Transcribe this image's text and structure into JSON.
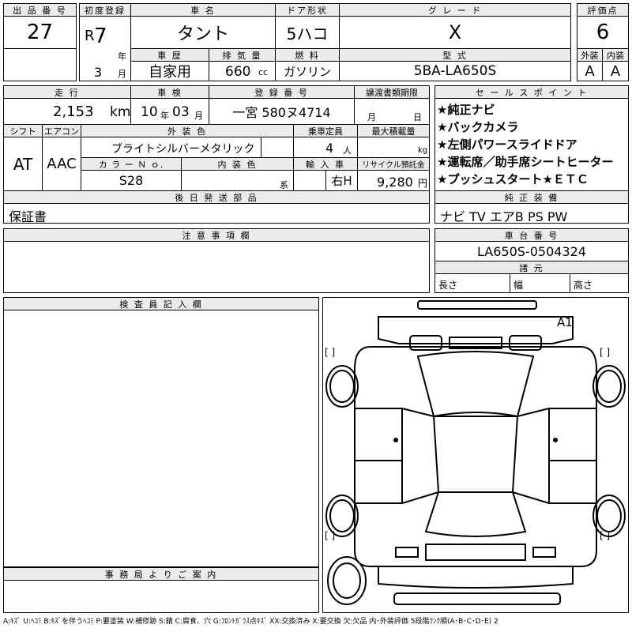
{
  "headers": {
    "lot_no": "出 品 番 号",
    "first_reg": "初度登録",
    "car_name": "車 名",
    "door": "ドア形状",
    "grade": "グ レ ー ド",
    "score": "評価点",
    "history": "車 歴",
    "displacement": "排 気 量",
    "fuel": "燃 料",
    "model": "型 式",
    "exterior": "外装",
    "interior": "内装",
    "mileage": "走 行",
    "inspection": "車 検",
    "plate": "登 録 番 号",
    "transfer": "譲渡書類期限",
    "selling": "セ ー ル ス ポ イ ン ト",
    "shift": "シフト",
    "ac": "エアコン",
    "color": "外 装 色",
    "capacity": "乗車定員",
    "load": "最大積載量",
    "color_no": "カ ラ ー Ｎ ｏ.",
    "int_color": "内 装 色",
    "import": "輸 入 車",
    "recycle": "リサイクル預託金",
    "later_parts": "後 日 発 送 部 品",
    "genuine": "純 正 装 備",
    "notes": "注 意 事 項 欄",
    "chassis": "車 台 番 号",
    "dims": "諸 元",
    "inspector": "検 査 員 記 入 欄",
    "office": "事 務 局 よ り ご 案 内"
  },
  "values": {
    "lot_no": "27",
    "era": "R",
    "year": "7",
    "year_unit": "年",
    "month": "3",
    "month_unit": "月",
    "car_name": "タント",
    "door": "5ハコ",
    "grade": "X",
    "score": "6",
    "history": "自家用",
    "displacement": "660",
    "displacement_unit": "cc",
    "fuel": "ガソリン",
    "model": "5BA-LA650S",
    "exterior": "A",
    "interior": "A",
    "mileage": "2,153",
    "mileage_unit": "km",
    "insp_year": "10",
    "insp_year_unit": "年",
    "insp_month": "03",
    "insp_month_unit": "月",
    "plate": "一宮 580ヌ4714",
    "transfer_month": "月",
    "transfer_day": "日",
    "shift": "AT",
    "ac": "AAC",
    "color": "ブライトシルバーメタリック",
    "capacity": "4",
    "capacity_unit": "人",
    "load_unit": "kg",
    "color_no": "S28",
    "int_color_unit": "系",
    "import": "右H",
    "recycle": "9,280",
    "recycle_unit": "円",
    "later_parts": "保証書",
    "genuine": "ナビ TV エアB PS PW",
    "chassis": "LA650S-0504324",
    "dim_length": "長さ",
    "dim_width": "幅",
    "dim_height": "高さ",
    "diagram_mark": "A1",
    "legend": "A:ｷｽﾞ U:ﾍｺﾐ B:ｷｽﾞを伴うﾍｺﾐ P:要塗装 W:補修跡 S:錆 C:腐食、穴 G:ﾌﾛﾝﾄｶﾞﾗｽ点ｷｽﾞ XX:交換済み X:要交換 欠:欠品 内･外装評価 5段階ﾗﾝｸ順(A･B･C･D･E) 2"
  },
  "selling_points": [
    "★純正ナビ",
    "★バックカメラ",
    "★左側パワースライドドア",
    "★運転席／助手席シートヒーター",
    "★プッシュスタート★ＥＴＣ"
  ],
  "bracket": "[   ]"
}
